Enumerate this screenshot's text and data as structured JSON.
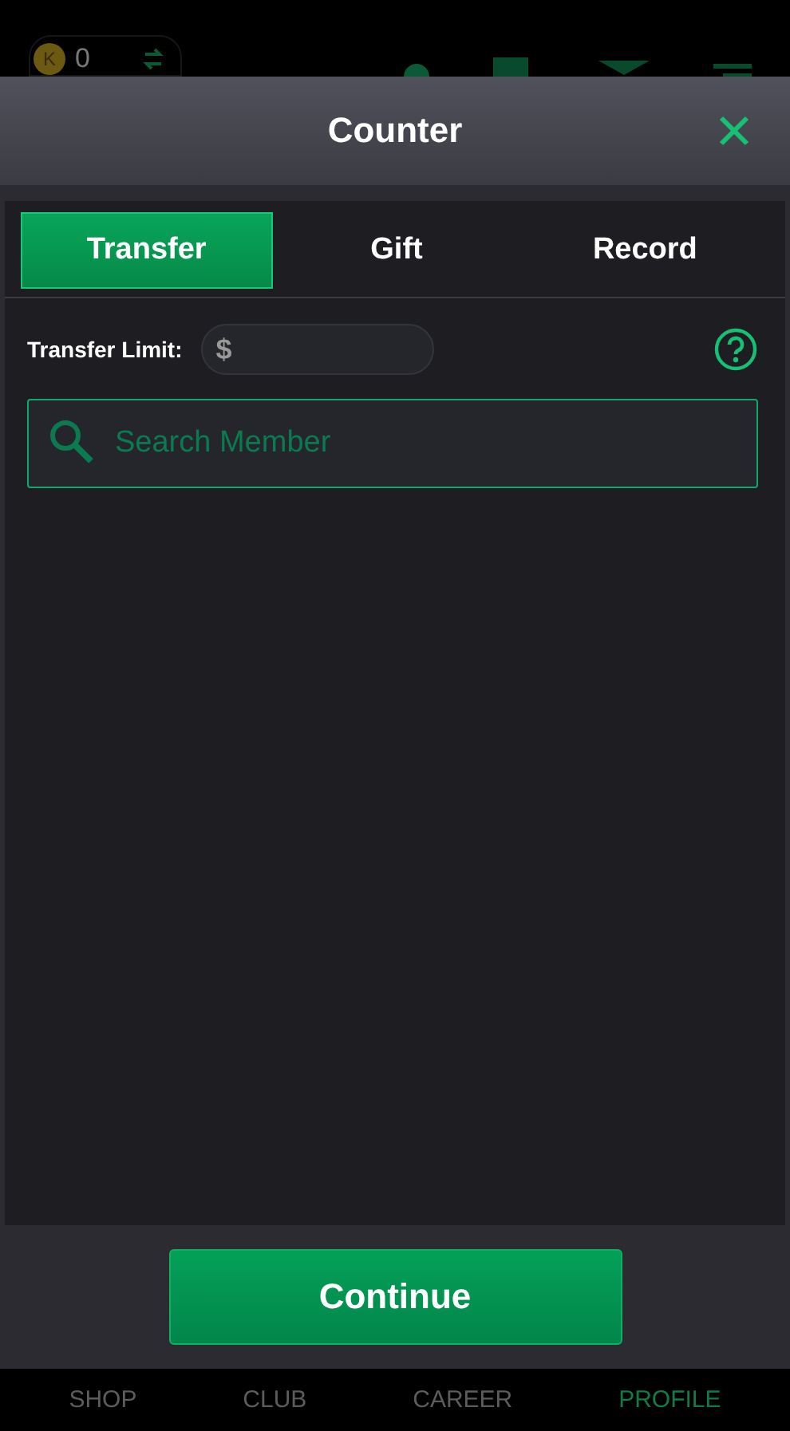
{
  "top_bar": {
    "coin_letter": "K",
    "balance": "0"
  },
  "dialog": {
    "title": "Counter",
    "tabs": [
      {
        "label": "Transfer",
        "selected": true
      },
      {
        "label": "Gift",
        "selected": false
      },
      {
        "label": "Record",
        "selected": false
      }
    ],
    "limit_label": "Transfer Limit:",
    "currency": "$",
    "search": {
      "placeholder": "Search Member"
    },
    "continue_button": "Continue"
  },
  "bottom_nav": [
    {
      "label": "SHOP",
      "selected": false
    },
    {
      "label": "CLUB",
      "selected": false
    },
    {
      "label": "CAREER",
      "selected": false
    },
    {
      "label": "PROFILE",
      "selected": true
    }
  ]
}
